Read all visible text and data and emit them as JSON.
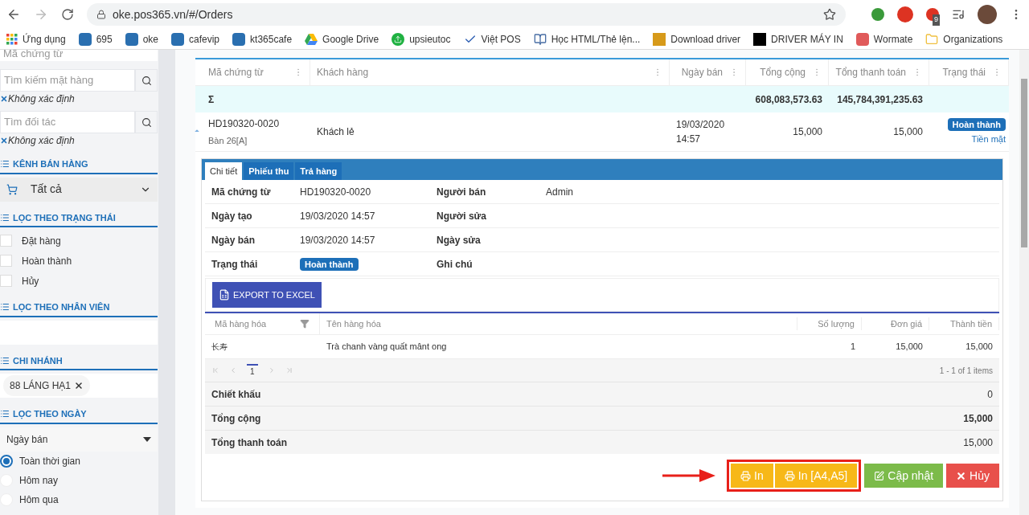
{
  "browser": {
    "url": "oke.pos365.vn/#/Orders",
    "extension_badge": "9"
  },
  "bookmarks": [
    {
      "label": "Ứng dụng",
      "kind": "apps"
    },
    {
      "label": "695",
      "kind": "pos"
    },
    {
      "label": "oke",
      "kind": "pos"
    },
    {
      "label": "cafevip",
      "kind": "pos"
    },
    {
      "label": "kt365cafe",
      "kind": "pos"
    },
    {
      "label": "Google Drive",
      "kind": "drive"
    },
    {
      "label": "upsieutoc",
      "kind": "upload"
    },
    {
      "label": "Việt POS",
      "kind": "check"
    },
    {
      "label": "Học HTML/Thẻ lện...",
      "kind": "books"
    },
    {
      "label": "Download driver",
      "kind": "letter_t"
    },
    {
      "label": "DRIVER MÁY IN",
      "kind": "letter_v"
    },
    {
      "label": "Wormate",
      "kind": "game"
    },
    {
      "label": "Organizations",
      "kind": "folder"
    }
  ],
  "sidebar": {
    "doc_field": {
      "placeholder": "Mã chứng từ"
    },
    "item_search": {
      "placeholder": "Tìm kiếm mặt hàng",
      "tag": "Không xác định"
    },
    "partner_search": {
      "placeholder": "Tìm đối tác",
      "tag": "Không xác định"
    },
    "channel": {
      "title": "KÊNH BÁN HÀNG",
      "value": "Tất cả"
    },
    "status_filter": {
      "title": "LỌC THEO TRẠNG THÁI",
      "items": [
        {
          "label": "Đặt hàng",
          "checked": false
        },
        {
          "label": "Hoàn thành",
          "checked": false
        },
        {
          "label": "Hủy",
          "checked": false
        }
      ]
    },
    "staff_filter": {
      "title": "LỌC THEO NHÂN VIÊN"
    },
    "branch": {
      "title": "CHI NHÁNH",
      "tag": "88 LÁNG HẠ1"
    },
    "date_filter": {
      "title": "LỌC THEO NGÀY",
      "value": "Ngày bán",
      "options": [
        {
          "label": "Toàn thời gian",
          "selected": true
        },
        {
          "label": "Hôm nay",
          "selected": false
        },
        {
          "label": "Hôm qua",
          "selected": false
        }
      ]
    }
  },
  "orders": {
    "columns": [
      "Mã chứng từ",
      "Khách hàng",
      "Ngày bán",
      "Tổng cộng",
      "Tổng thanh toán",
      "Trạng thái"
    ],
    "summary": {
      "symbol": "Σ",
      "total": "608,083,573.63",
      "paid": "145,784,391,235.63"
    },
    "row": {
      "code": "HD190320-0020",
      "table": "Bàn 26[A]",
      "customer": "Khách lẻ",
      "date": "19/03/2020",
      "time": "14:57",
      "total": "15,000",
      "paid": "15,000",
      "status": "Hoàn thành",
      "payment": "Tiền mặt",
      "expanded": true
    }
  },
  "detail": {
    "tabs": [
      {
        "label": "Chi tiết",
        "selected": true
      },
      {
        "label": "Phiếu thu",
        "selected": false
      },
      {
        "label": "Trả hàng",
        "selected": false
      }
    ],
    "fields": [
      {
        "label": "Mã chứng từ",
        "value": "HD190320-0020",
        "label2": "Người bán",
        "value2": "Admin"
      },
      {
        "label": "Ngày tạo",
        "value": "19/03/2020 14:57",
        "label2": "Người sửa"
      },
      {
        "label": "Ngày bán",
        "value": "19/03/2020 14:57",
        "label2": "Ngày sửa"
      },
      {
        "label": "Trạng thái",
        "badge": "Hoàn thành",
        "label2": "Ghi chú"
      }
    ],
    "export_button": "EXPORT TO EXCEL",
    "items": {
      "columns": [
        "Mã hàng hóa",
        "Tên hàng hóa",
        "Số lượng",
        "Đơn giá",
        "Thành tiền"
      ],
      "rows": [
        {
          "code": "长寿",
          "name": "Trà chanh vàng quất mânt ong",
          "qty": "1",
          "price": "15,000",
          "amount": "15,000"
        }
      ],
      "page": "1",
      "range": "1 - 1 of 1 items"
    },
    "totals": [
      {
        "label": "Chiết khấu",
        "value": "0",
        "bold": false
      },
      {
        "label": "Tổng cộng",
        "value": "15,000",
        "bold": true
      },
      {
        "label": "Tổng thanh toán",
        "value": "15,000",
        "bold": false
      }
    ],
    "buttons": [
      {
        "label": "In",
        "kind": "print",
        "highlighted": true
      },
      {
        "label": "In [A4,A5]",
        "kind": "print",
        "highlighted": true
      },
      {
        "label": "Cập nhật",
        "kind": "update",
        "highlighted": false
      },
      {
        "label": "Hủy",
        "kind": "cancel",
        "highlighted": false
      }
    ]
  }
}
